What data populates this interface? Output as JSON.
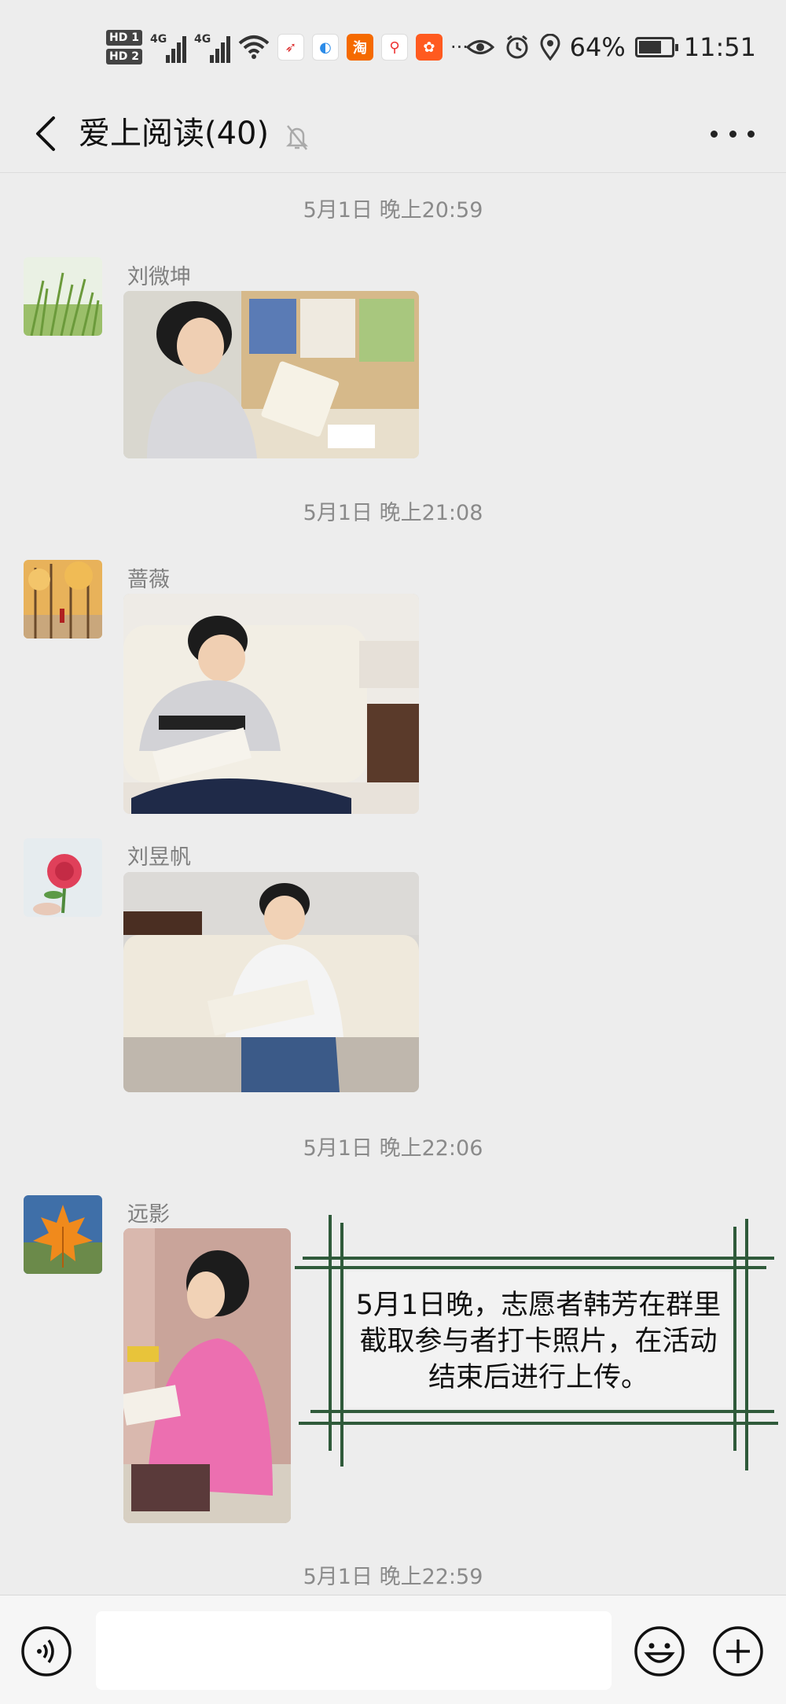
{
  "status_bar": {
    "hd1": "HD 1",
    "hd2": "HD 2",
    "net1": "4G",
    "net2": "4G",
    "taobao": "淘",
    "more": "···",
    "battery_percent": "64%",
    "battery_level": 0.64,
    "time": "11:51"
  },
  "header": {
    "title": "爱上阅读(40)",
    "icons": {
      "back": "chevron-left-icon",
      "mute": "bell-off-icon",
      "more": "more-dots-icon"
    }
  },
  "messages": [
    {
      "time": "5月1日 晚上20:59",
      "sender": "刘微坤",
      "avatar": "grass-avatar",
      "photo": "girl-reading-at-desk"
    },
    {
      "time": "5月1日 晚上21:08",
      "sender": "蔷薇",
      "avatar": "autumn-trees-avatar",
      "photo": "boy-reading-on-sofa"
    },
    {
      "time": "",
      "sender": "刘昱帆",
      "avatar": "rose-avatar",
      "photo": "girl-reading-on-sofa"
    },
    {
      "time": "5月1日 晚上22:06",
      "sender": "远影",
      "avatar": "maple-leaf-avatar",
      "photo": "girl-in-pink-reading"
    }
  ],
  "last_time": "5月1日 晚上22:59",
  "caption": "5月1日晚，志愿者韩芳在群里截取参与者打卡照片，在活动结束后进行上传。",
  "input_bar": {
    "icons": {
      "voice": "voice-icon",
      "emoji": "emoji-icon",
      "plus": "plus-icon"
    }
  },
  "colors": {
    "background": "#ededed",
    "caption_frame": "#2f5a3a",
    "input_bar": "#f6f6f6"
  }
}
